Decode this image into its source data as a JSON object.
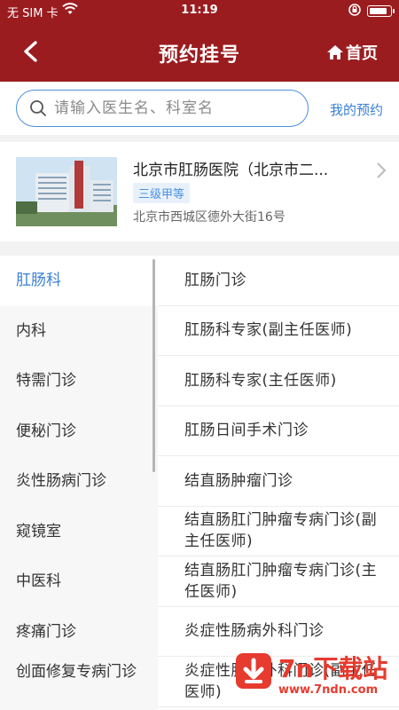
{
  "status_bar": {
    "carrier": "无 SIM 卡",
    "time": "11:19",
    "battery_level": 0.9
  },
  "nav": {
    "title": "预约挂号",
    "home_label": "首页"
  },
  "search": {
    "placeholder": "请输入医生名、科室名",
    "my_appointment": "我的预约"
  },
  "hospital": {
    "name": "北京市肛肠医院（北京市二...",
    "level": "三级甲等",
    "address": "北京市西城区德外大街16号"
  },
  "departments": [
    {
      "label": "肛肠科",
      "active": true
    },
    {
      "label": "内科",
      "active": false
    },
    {
      "label": "特需门诊",
      "active": false
    },
    {
      "label": "便秘门诊",
      "active": false
    },
    {
      "label": "炎性肠病门诊",
      "active": false
    },
    {
      "label": "窥镜室",
      "active": false
    },
    {
      "label": "中医科",
      "active": false
    },
    {
      "label": "疼痛门诊",
      "active": false
    },
    {
      "label": "创面修复专病门诊",
      "active": false
    }
  ],
  "clinics": [
    "肛肠门诊",
    "肛肠科专家(副主任医师)",
    "肛肠科专家(主任医师)",
    "肛肠日间手术门诊",
    "结直肠肿瘤门诊",
    "结直肠肛门肿瘤专病门诊(副主任医师)",
    "结直肠肛门肿瘤专病门诊(主任医师)",
    "炎症性肠病外科门诊",
    "炎症性肠病外科门诊(副主任医师)"
  ],
  "watermark": {
    "brand": "7n下载站",
    "url": "www.7ndn.com"
  },
  "colors": {
    "header": "#9b1c1f",
    "accent": "#3a7fd5",
    "watermark": "#e63b2e"
  }
}
